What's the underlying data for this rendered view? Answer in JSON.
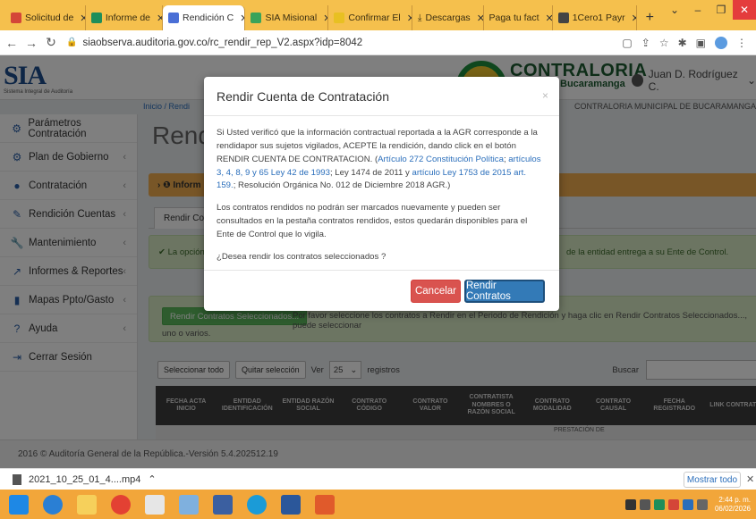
{
  "browser": {
    "tabs": [
      {
        "label": "Solicitud de",
        "icon": "gmail-icon",
        "color": "#d44638",
        "active": false
      },
      {
        "label": "Informe de",
        "icon": "drive-icon",
        "color": "#1f8e5a",
        "active": false
      },
      {
        "label": "Rendición C",
        "icon": "page-icon",
        "color": "#4a6fd6",
        "active": true
      },
      {
        "label": "SIA Misional",
        "icon": "chart-icon",
        "color": "#3aa35a",
        "active": false
      },
      {
        "label": "Confirmar El",
        "icon": "check-icon",
        "color": "#e8c022",
        "active": false
      },
      {
        "label": "Descargas",
        "icon": "download-icon",
        "color": "#555555",
        "active": false
      },
      {
        "label": "Paga tu fact",
        "icon": "page-icon",
        "color": "#999999",
        "active": false
      },
      {
        "label": "1Cero1 Payr",
        "icon": "app-icon",
        "color": "#444444",
        "active": false
      }
    ],
    "url": "siaobserva.auditoria.gov.co/rc_rendir_rep_V2.aspx?idp=8042"
  },
  "header": {
    "sia_logo": "SIA",
    "sia_sub": "Sistema Integral de Auditoría",
    "contraloria": "CONTRALORIA",
    "city": "Bucaramanga",
    "user": "Juan D. Rodríguez C.",
    "entity": "CONTRALORIA MUNICIPAL DE BUCARAMANGA",
    "breadcrumb": "Inicio / Rendi"
  },
  "sidebar": {
    "items": [
      {
        "label": "Parámetros Contratación",
        "icon": "gears-icon"
      },
      {
        "label": "Plan de Gobierno",
        "icon": "gears-icon"
      },
      {
        "label": "Contratación",
        "icon": "circle-icon"
      },
      {
        "label": "Rendición Cuentas",
        "icon": "edit-icon"
      },
      {
        "label": "Mantenimiento",
        "icon": "wrench-icon"
      },
      {
        "label": "Informes & Reportes",
        "icon": "chart-line-icon"
      },
      {
        "label": "Mapas Ppto/Gasto",
        "icon": "book-icon"
      },
      {
        "label": "Ayuda",
        "icon": "question-icon"
      },
      {
        "label": "Cerrar Sesión",
        "icon": "logout-icon"
      }
    ]
  },
  "main": {
    "title": "Rendi",
    "info_label": "Inform",
    "tab_label": "Rendir Contr",
    "alert_left": "La opción",
    "alert_right": "de la entidad entrega a su Ente de Control.",
    "action_button": "Rendir Contratos Seleccionados...",
    "action_text": "Por favor seleccione los contratos a Rendir en el Periodo de Rendición y haga clic en Rendir Contratos Seleccionados..., puede seleccionar",
    "action_text2": "uno o varios.",
    "select_all": "Seleccionar todo",
    "deselect": "Quitar selección",
    "ver_label": "Ver",
    "per_page": "25",
    "registros": "registros",
    "search_label": "Buscar",
    "table_headers": [
      "FECHA ACTA INICIO",
      "ENTIDAD IDENTIFICACIÓN",
      "ENTIDAD RAZÓN SOCIAL",
      "CONTRATO CÓDIGO",
      "CONTRATO VALOR",
      "CONTRATISTA NOMBRES O RAZÓN SOCIAL",
      "CONTRATO MODALIDAD",
      "CONTRATO CAUSAL",
      "FECHA REGISTRADO",
      "LINK CONTRATO"
    ],
    "row_text": "PRESTACIÓN DE"
  },
  "modal": {
    "title": "Rendir Cuenta de Contratación",
    "close": "×",
    "p1_text": "Si Usted verificó que la información contractual reportada a la AGR corresponde a la rendidapor sus sujetos vigilados, ACEPTE la rendición, dando click en el botón RENDIR CUENTA DE CONTRATACION. (",
    "link1": "Artículo 272 Constitución Política",
    "sep1": "; ",
    "link2": "artículos 3, 4, 8, 9 y 65 Ley 42 de 1993",
    "mid1": "; Ley 1474 de 2011 y ",
    "link3": "artículo Ley 1753 de 2015 art. 159.",
    "tail1": "; Resolución Orgánica No. 012 de Diciembre 2018 AGR.)",
    "p2": "Los contratos rendidos no podrán ser marcados nuevamente y pueden ser consultados en la pestaña contratos rendidos, estos quedarán disponibles para el Ente de Control que lo vigila.",
    "p3": "¿Desea rendir los contratos seleccionados ?",
    "cancel": "Cancelar",
    "confirm": "Rendir Contratos"
  },
  "footer": "2016 © Auditoría General de la República.-Versión 5.4.202512.19",
  "downloads": {
    "file": "2021_10_25_01_4....mp4",
    "show_all": "Mostrar todo"
  },
  "taskbar": {
    "time": "2:44 p. m.",
    "date": "06/02/2026"
  },
  "colors": {
    "accent_orange": "#f0ad4e",
    "success_green": "#5cb85c",
    "danger_red": "#d9534f",
    "primary_blue": "#337ab7"
  }
}
